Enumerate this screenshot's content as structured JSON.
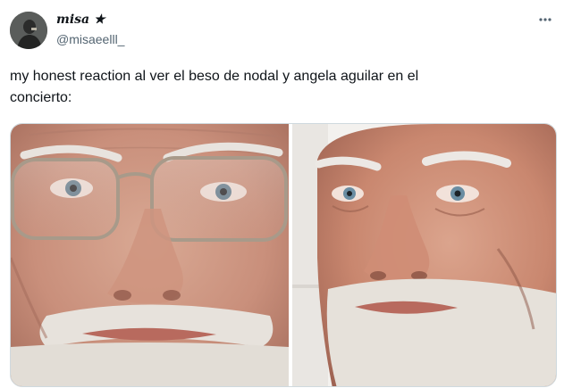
{
  "author": {
    "display_name": "misa ★",
    "handle": "@misaeelll_"
  },
  "tweet": {
    "text_line1": "my honest reaction al ver el beso de nodal y angela aguilar en el",
    "text_line2": "concierto:"
  },
  "icons": {
    "more": "more-horizontal-icon",
    "avatar": "user-avatar"
  },
  "colors": {
    "text_primary": "#0f1419",
    "text_secondary": "#536471",
    "border": "#cfd9de"
  }
}
